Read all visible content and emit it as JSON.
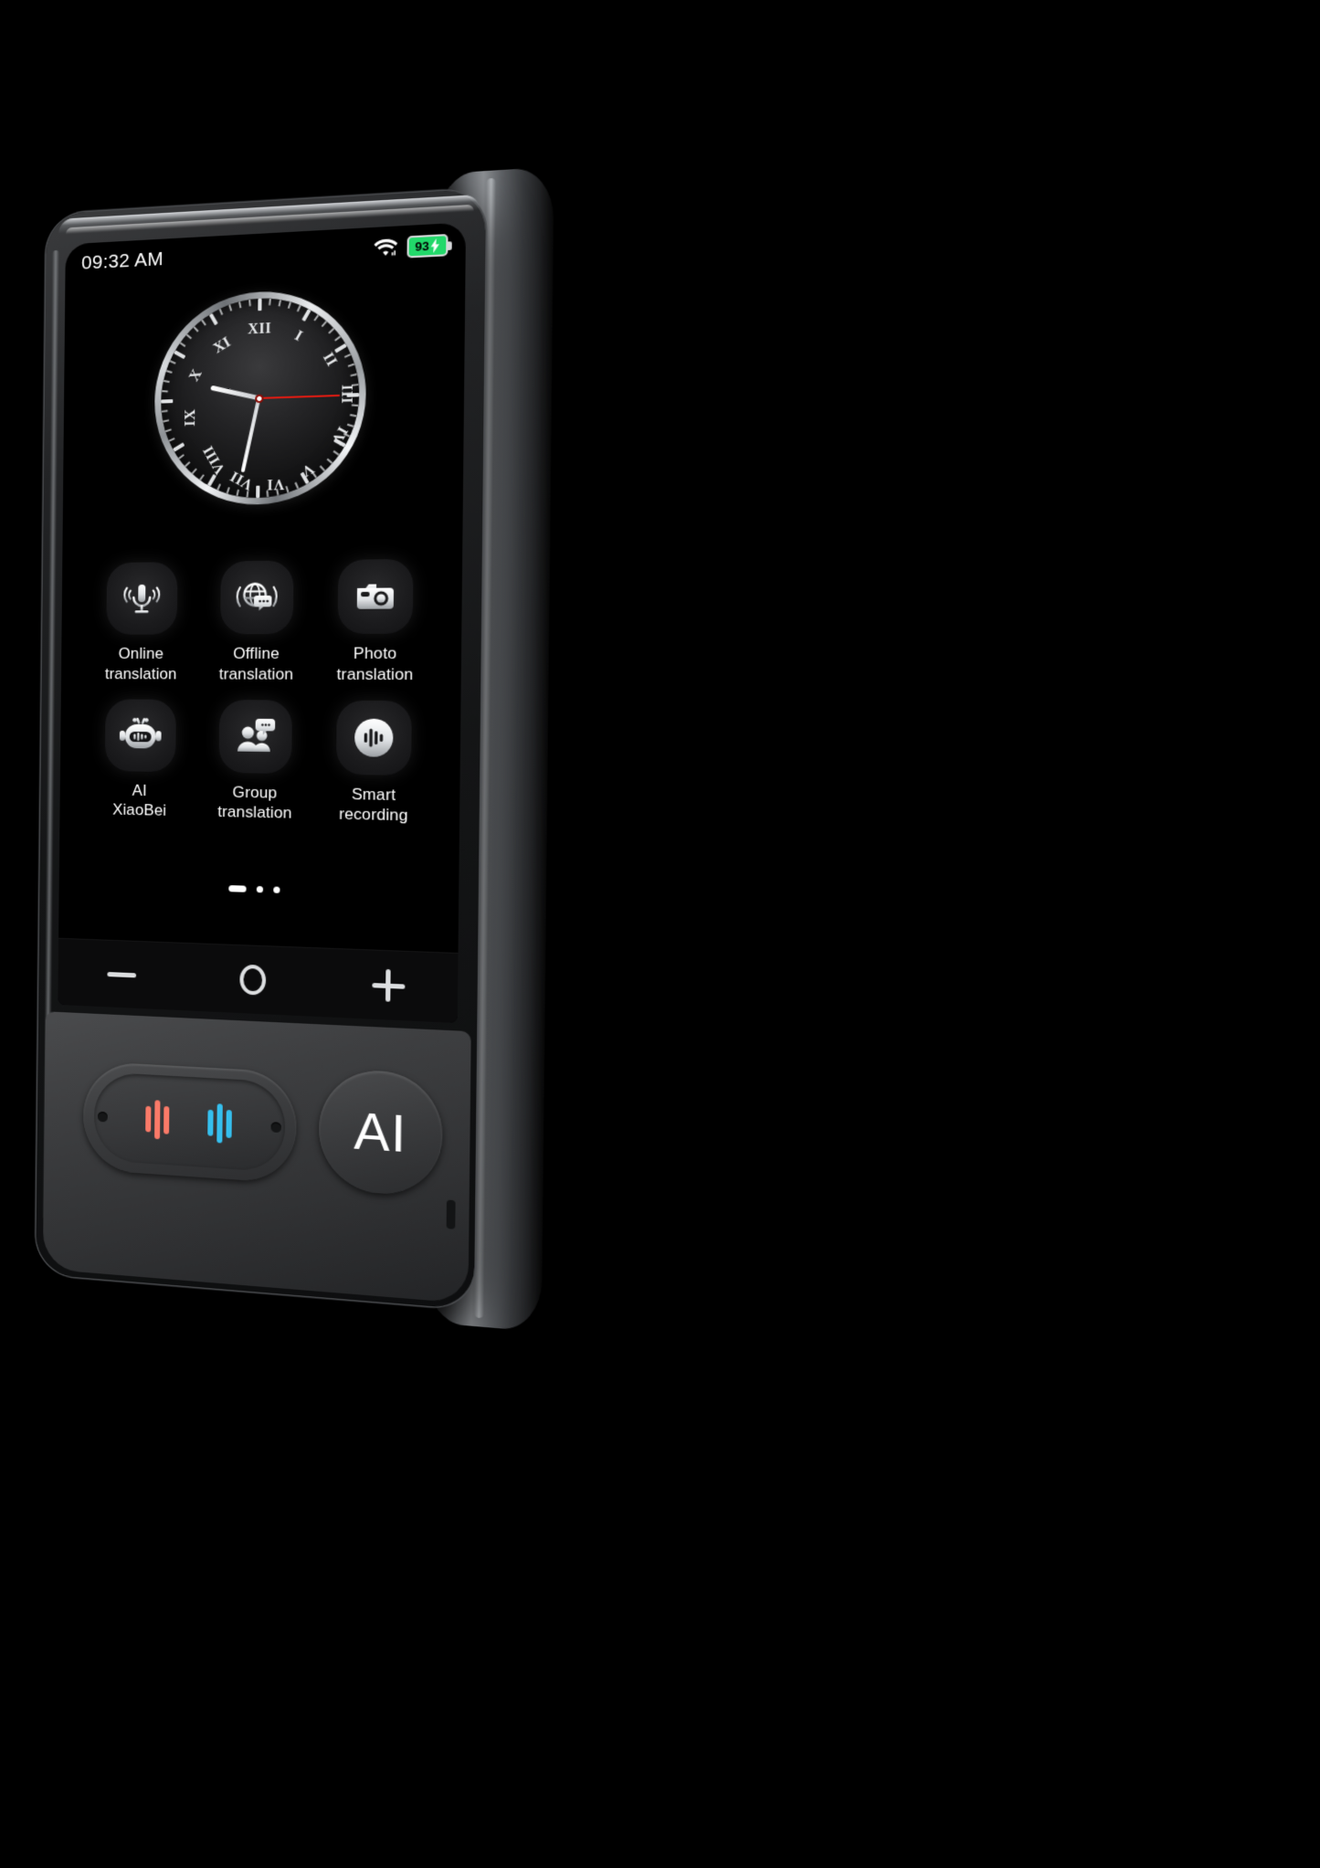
{
  "device": {
    "name": "ai-translator-device",
    "shell_color": "#1a1b1c",
    "chin_color": "#3a3b3d",
    "side_color": "#6e7175"
  },
  "status_bar": {
    "time": "09:32 AM",
    "wifi_icon": "wifi-icon",
    "battery": {
      "percent": "93",
      "charging_icon": "charging-bolt-icon",
      "color": "#22d86a"
    }
  },
  "clock_widget": {
    "name": "analog-clock",
    "style": "roman-numeral",
    "numerals": [
      "XII",
      "I",
      "II",
      "III",
      "IV",
      "V",
      "VI",
      "VII",
      "VIII",
      "IX",
      "X",
      "XI"
    ],
    "hour_angle_deg": 284,
    "minute_angle_deg": 192,
    "second_angle_deg": 90,
    "second_hand_color": "#e01b12",
    "face_color": "#1a1a1c",
    "bezel_color": "#d8dbde"
  },
  "apps": [
    {
      "id": "online-translation",
      "label_line1": "Online",
      "label_line2": "translation",
      "icon": "microphone-waves-icon"
    },
    {
      "id": "offline-translation",
      "label_line1": "Offline",
      "label_line2": "translation",
      "icon": "globe-speech-icon"
    },
    {
      "id": "photo-translation",
      "label_line1": "Photo",
      "label_line2": "translation",
      "icon": "camera-icon"
    },
    {
      "id": "ai-xiaobei",
      "label_line1": "AI",
      "label_line2": "XiaoBei",
      "icon": "robot-face-icon"
    },
    {
      "id": "group-translation",
      "label_line1": "Group",
      "label_line2": "translation",
      "icon": "people-speech-icon"
    },
    {
      "id": "smart-recording",
      "label_line1": "Smart",
      "label_line2": "recording",
      "icon": "waveform-circle-icon"
    }
  ],
  "pager": {
    "total": 3,
    "active_index": 0
  },
  "navbar": {
    "back_icon": "minus-icon",
    "home_icon": "circle-icon",
    "menu_icon": "plus-icon"
  },
  "hardware": {
    "translate_button": {
      "name": "two-way-translate-button",
      "left_waveform_color": "#fa7a68",
      "right_waveform_color": "#35bfee"
    },
    "ai_button": {
      "name": "ai-assistant-button",
      "label": "AI"
    }
  }
}
